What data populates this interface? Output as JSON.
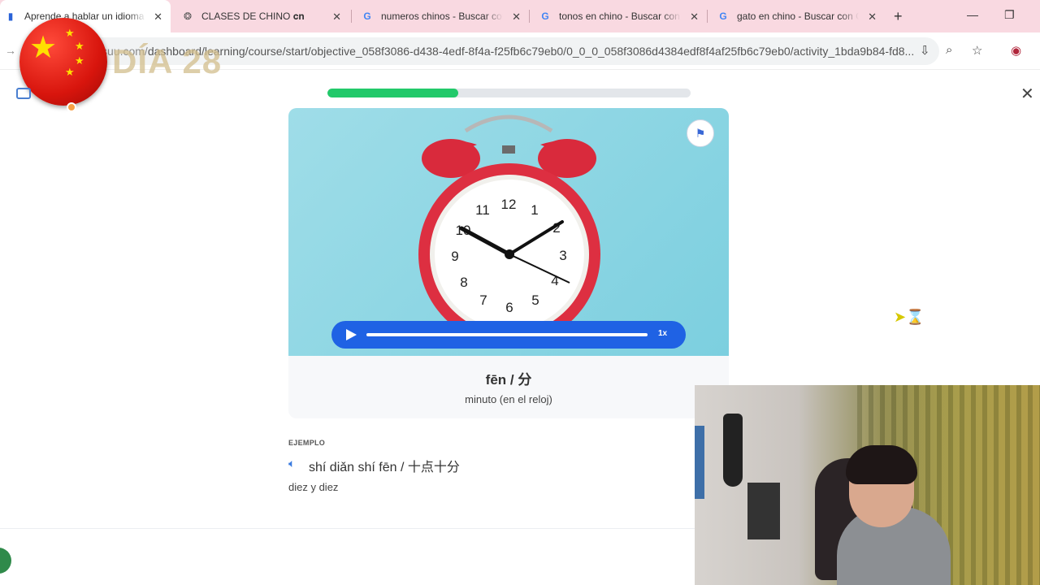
{
  "browser": {
    "tabs": [
      {
        "title": "Aprende a hablar un idioma",
        "favicon": "busuu-icon",
        "active": true
      },
      {
        "title": "CLASES DE CHINO 𝐜𝐧",
        "favicon": "chatgpt-icon",
        "active": false
      },
      {
        "title": "numeros chinos - Buscar con Google",
        "favicon": "google-icon",
        "active": false
      },
      {
        "title": "tonos en chino - Buscar con Google",
        "favicon": "google-icon",
        "active": false
      },
      {
        "title": "gato en chino - Buscar con Google",
        "favicon": "google-icon",
        "active": false
      }
    ],
    "url_host": "suu.com/",
    "url_path": "dashboard/learning/course/start/objective_058f3086-d438-4edf-8f4a-f25fb6c79eb0/0_0_0_058f3086d4384edf8f4af25fb6c79eb0/activity_1bda9b84-fd8...",
    "new_tab_icon": "plus-icon",
    "window_controls": [
      "minimize-icon",
      "restore-icon"
    ]
  },
  "overlay": {
    "day_label": "DÍA 28",
    "flag": "china-flag"
  },
  "lesson": {
    "progress_percent": 36,
    "image_subject": "alarm-clock",
    "audio": {
      "speed": "1x"
    },
    "word": "fēn / 分",
    "meaning": "minuto (en el reloj)",
    "example_label": "EJEMPLO",
    "example_text": "shí diǎn shí fēn / 十点十分",
    "example_translation": "diez y diez"
  },
  "colors": {
    "tabbar": "#f9d9e1",
    "progress": "#22c96a",
    "audio_bar": "#1f62e4",
    "accent": "#3a7be0"
  }
}
